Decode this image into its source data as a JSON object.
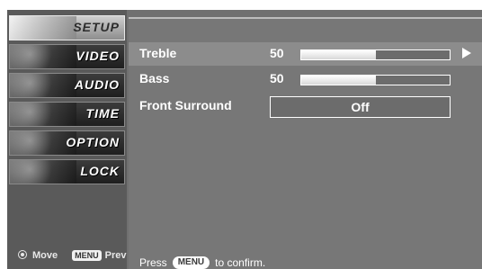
{
  "sidebar": {
    "items": [
      {
        "label": "SETUP",
        "active": true
      },
      {
        "label": "VIDEO",
        "active": false
      },
      {
        "label": "AUDIO",
        "active": false
      },
      {
        "label": "TIME",
        "active": false
      },
      {
        "label": "OPTION",
        "active": false
      },
      {
        "label": "LOCK",
        "active": false
      }
    ],
    "hint": {
      "move_label": "Move",
      "prev_badge": "MENU",
      "prev_label": "Prev"
    }
  },
  "audio": {
    "rows": [
      {
        "label": "Treble",
        "value": "50",
        "percent": 0.5,
        "selected": true
      },
      {
        "label": "Bass",
        "value": "50",
        "percent": 0.5,
        "selected": false
      }
    ],
    "front_surround": {
      "label": "Front Surround",
      "value": "Off"
    }
  },
  "footer": {
    "prefix": "Press",
    "badge": "MENU",
    "suffix": "to confirm."
  },
  "colors": {
    "panel": "#777777",
    "sidebar": "#5a5a5a",
    "highlight": "#8c8c8c",
    "text": "#ffffff"
  }
}
